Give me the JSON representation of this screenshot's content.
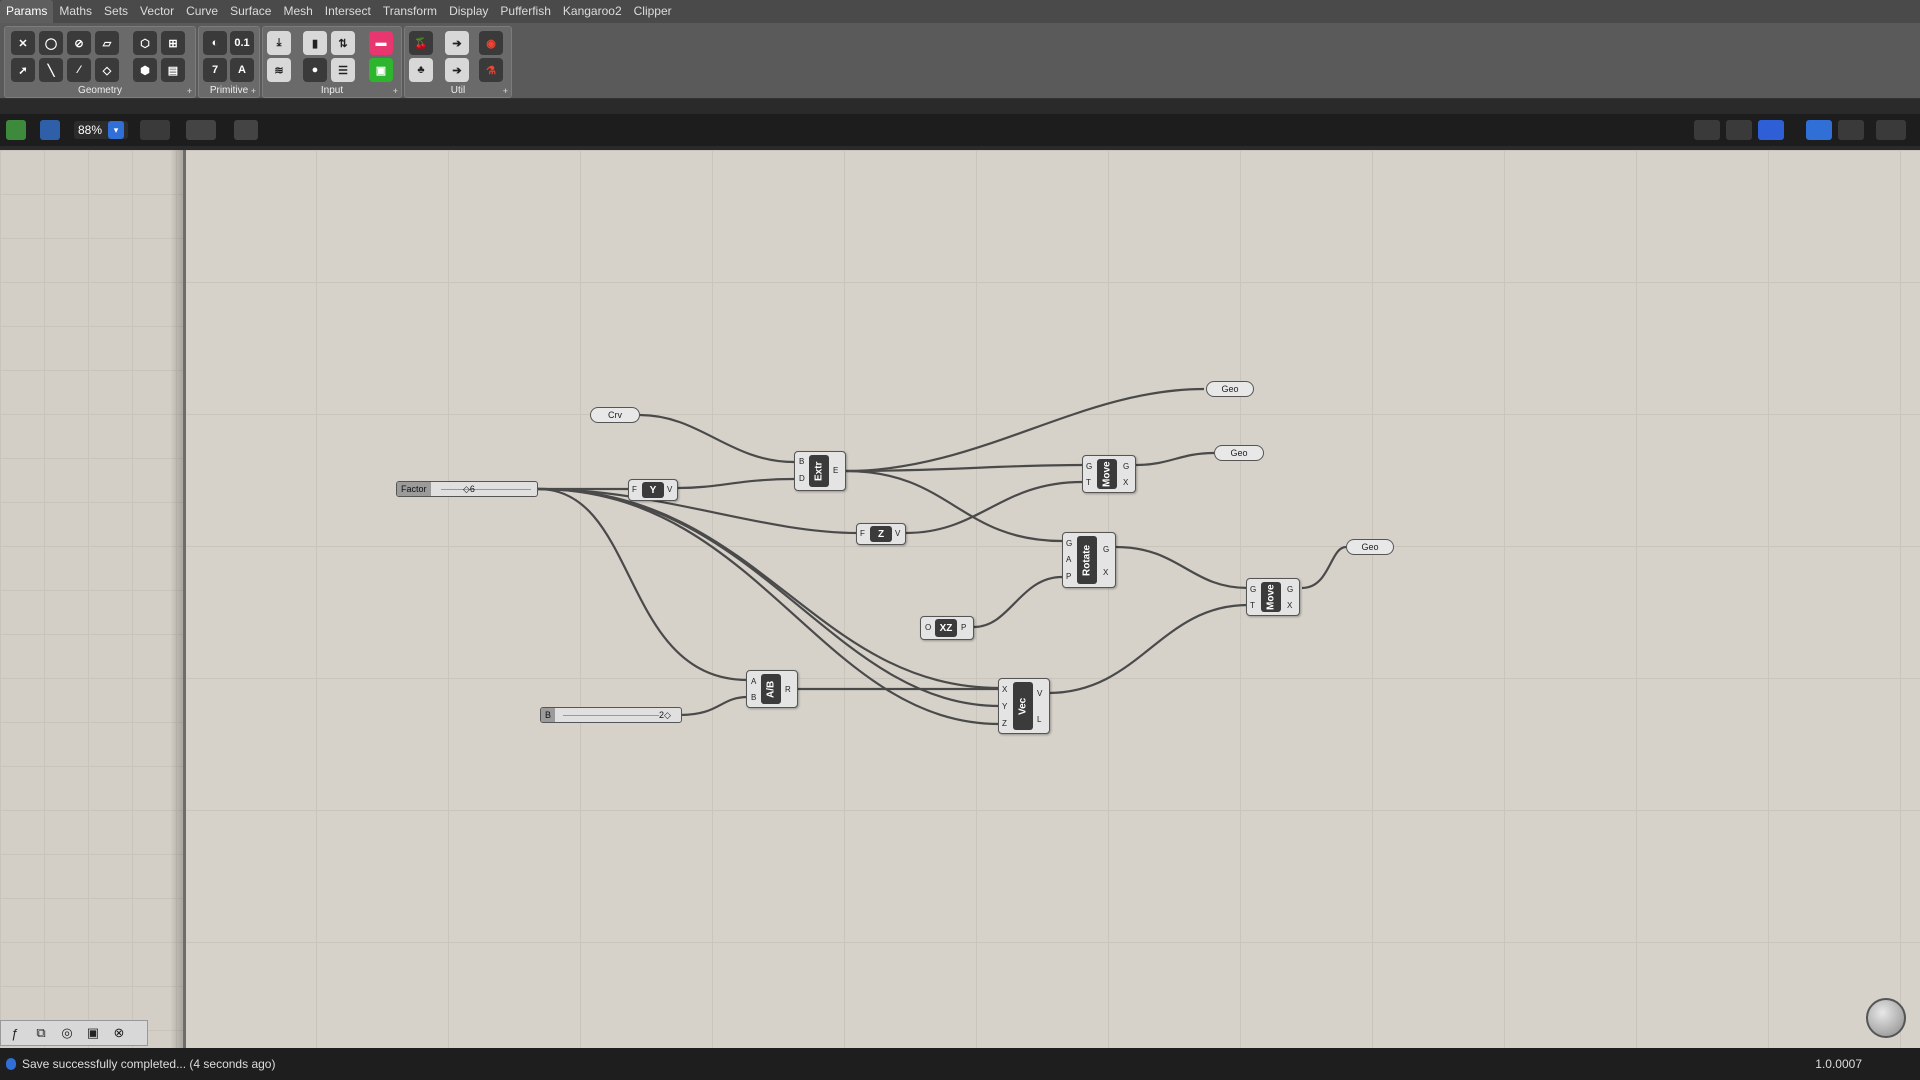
{
  "tabs": [
    "Params",
    "Maths",
    "Sets",
    "Vector",
    "Curve",
    "Surface",
    "Mesh",
    "Intersect",
    "Transform",
    "Display",
    "Pufferfish",
    "Kangaroo2",
    "Clipper"
  ],
  "ribbon": {
    "panels": [
      "Geometry",
      "Primitive",
      "Input",
      "Util"
    ],
    "primitive_buttons": [
      "0.1",
      "7",
      "A"
    ]
  },
  "toolbar": {
    "zoom": "88%"
  },
  "canvas": {
    "params": {
      "crv": "Crv",
      "geo1": "Geo",
      "geo2": "Geo",
      "geo3": "Geo"
    },
    "sliders": {
      "factor": {
        "name": "Factor",
        "value": "6"
      },
      "b": {
        "name": "B",
        "value": "2"
      }
    },
    "components": {
      "extr": {
        "label": "Extr",
        "inputs": [
          "B",
          "D"
        ],
        "outputs": [
          "E"
        ]
      },
      "unit_y": {
        "label": "Y",
        "inputs": [
          "F"
        ],
        "outputs": [
          "V"
        ]
      },
      "unit_z": {
        "label": "Z",
        "inputs": [
          "F"
        ],
        "outputs": [
          "V"
        ]
      },
      "move1": {
        "label": "Move",
        "inputs": [
          "G",
          "T"
        ],
        "outputs": [
          "G",
          "X"
        ]
      },
      "rotate": {
        "label": "Rotate",
        "inputs": [
          "G",
          "A",
          "P"
        ],
        "outputs": [
          "G",
          "X"
        ]
      },
      "xz": {
        "label": "XZ",
        "inputs": [
          "O"
        ],
        "outputs": [
          "P"
        ]
      },
      "move2": {
        "label": "Move",
        "inputs": [
          "G",
          "T"
        ],
        "outputs": [
          "G",
          "X"
        ]
      },
      "div": {
        "label": "A/B",
        "inputs": [
          "A",
          "B"
        ],
        "outputs": [
          "R"
        ]
      },
      "vec": {
        "label": "Vec",
        "inputs": [
          "X",
          "Y",
          "Z"
        ],
        "outputs": [
          "V",
          "L"
        ]
      }
    }
  },
  "status": {
    "message": "Save successfully completed... (4 seconds ago)",
    "version": "1.0.0007"
  },
  "colors": {
    "canvas": "#d6d2ca",
    "wire": "#4a4a4a",
    "status_blue": "#2f6fd6"
  }
}
